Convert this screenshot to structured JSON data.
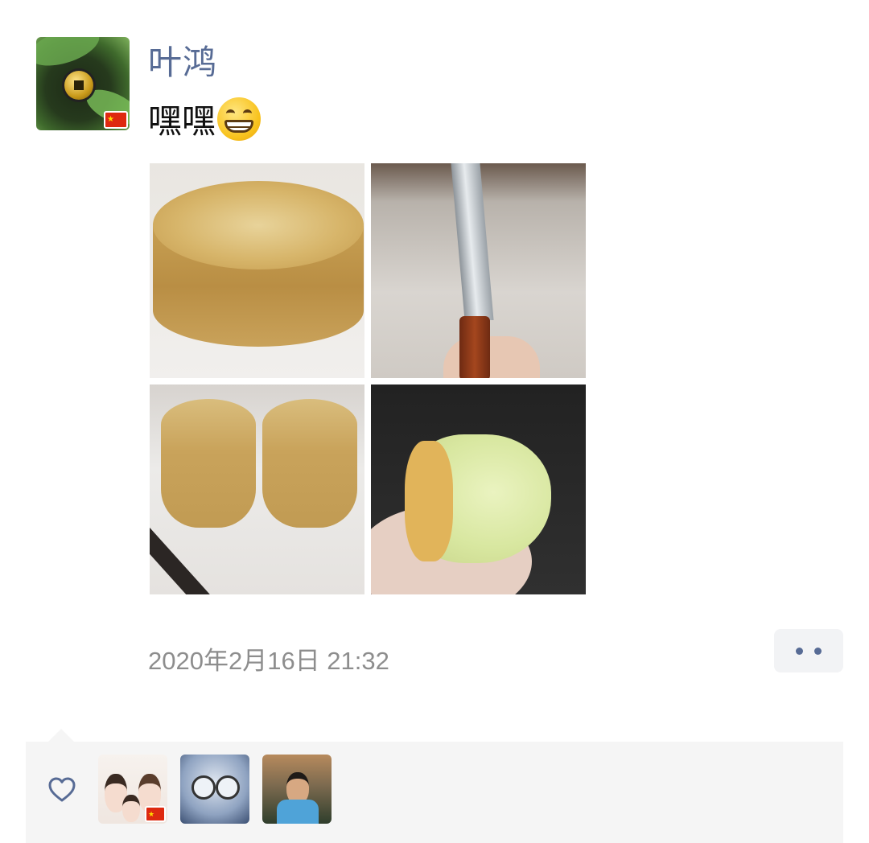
{
  "post": {
    "username": "叶鸿",
    "text": "嘿嘿",
    "emoji": "grinning-face-emoji",
    "timestamp": "2020年2月16日 21:32",
    "photos": [
      {
        "name": "sponge-cake-whole"
      },
      {
        "name": "bread-knife"
      },
      {
        "name": "sponge-cake-cut"
      },
      {
        "name": "cake-piece-in-hand"
      }
    ]
  },
  "likes": {
    "icon": "heart-icon",
    "avatars": [
      {
        "name": "liker-avatar-1"
      },
      {
        "name": "liker-avatar-2"
      },
      {
        "name": "liker-avatar-3"
      }
    ]
  },
  "colors": {
    "username": "#576b95",
    "timestamp": "#8d8d8d",
    "likes_panel": "#f5f5f5",
    "more_dots": "#576b95"
  }
}
